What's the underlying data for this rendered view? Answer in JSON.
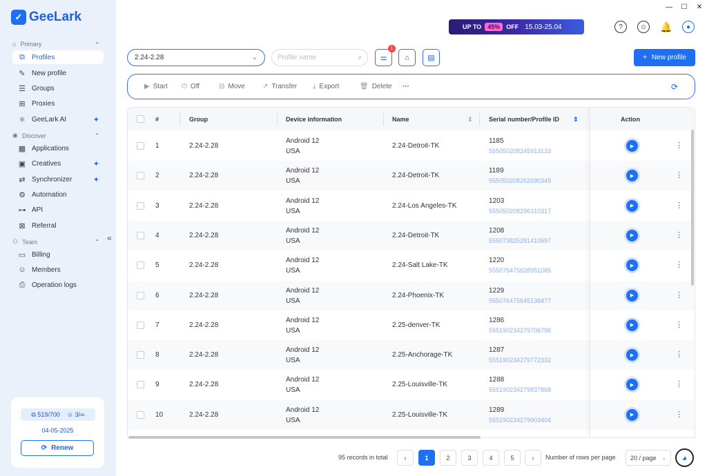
{
  "app": {
    "logo_text": "GeeLark",
    "logo_icon": "geelark-logo-icon"
  },
  "sidebar": {
    "sections": [
      {
        "label": "Primary",
        "icon": "home-icon"
      },
      {
        "label": "Discover",
        "icon": "eye-icon"
      },
      {
        "label": "Team",
        "icon": "team-icon"
      }
    ],
    "items": [
      {
        "label": "Profiles",
        "icon": "profiles-icon",
        "active": true
      },
      {
        "label": "New profile",
        "icon": "edit-icon"
      },
      {
        "label": "Groups",
        "icon": "list-icon"
      },
      {
        "label": "Proxies",
        "icon": "proxy-icon"
      },
      {
        "label": "GeeLark AI",
        "icon": "ai-icon",
        "badge": true
      },
      {
        "label": "Applications",
        "icon": "apps-icon"
      },
      {
        "label": "Creatives",
        "icon": "creatives-icon",
        "badge": true
      },
      {
        "label": "Synchronizer",
        "icon": "sync-icon",
        "badge": true
      },
      {
        "label": "Automation",
        "icon": "automation-icon"
      },
      {
        "label": "API",
        "icon": "api-icon"
      },
      {
        "label": "Referral",
        "icon": "referral-icon"
      },
      {
        "label": "Billing",
        "icon": "billing-icon"
      },
      {
        "label": "Members",
        "icon": "members-icon"
      },
      {
        "label": "Operation logs",
        "icon": "logs-icon"
      }
    ],
    "quota": {
      "profiles": "519/700",
      "members": "3/∞",
      "date": "04-05-2025",
      "renew_label": "Renew"
    }
  },
  "promo": {
    "prefix": "UP TO",
    "percent": "45%",
    "suffix": "OFF",
    "dates": "15.03-25.04"
  },
  "filters": {
    "group_value": "2.24-2.28",
    "search_placeholder": "Profile name",
    "notification_count": "1",
    "new_profile_label": "New profile"
  },
  "toolbar": {
    "start": "Start",
    "off": "Off",
    "move": "Move",
    "transfer": "Transfer",
    "export": "Export",
    "delete": "Delete",
    "more": "···"
  },
  "table": {
    "headers": {
      "num": "#",
      "group": "Group",
      "device": "Device information",
      "name": "Name",
      "serial": "Serial number/Profile ID",
      "action": "Action"
    },
    "rows": [
      {
        "num": "1",
        "group": "2.24-2.28",
        "os": "Android 12",
        "region": "USA",
        "name": "2.24-Detroit-TK",
        "serial": "1185",
        "pid": "555050208245913133"
      },
      {
        "num": "2",
        "group": "2.24-2.28",
        "os": "Android 12",
        "region": "USA",
        "name": "2.24-Detroit-TK",
        "serial": "1189",
        "pid": "555050208262690349"
      },
      {
        "num": "3",
        "group": "2.24-2.28",
        "os": "Android 12",
        "region": "USA",
        "name": "2.24-Los Angeles-TK",
        "serial": "1203",
        "pid": "555050208296310317"
      },
      {
        "num": "4",
        "group": "2.24-2.28",
        "os": "Android 12",
        "region": "USA",
        "name": "2.24-Detroit-TK",
        "serial": "1208",
        "pid": "555073825281410697"
      },
      {
        "num": "5",
        "group": "2.24-2.28",
        "os": "Android 12",
        "region": "USA",
        "name": "2.24-Salt Lake-TK",
        "serial": "1220",
        "pid": "555076475628951085"
      },
      {
        "num": "6",
        "group": "2.24-2.28",
        "os": "Android 12",
        "region": "USA",
        "name": "2.24-Phoenix-TK",
        "serial": "1229",
        "pid": "555076475645138477"
      },
      {
        "num": "7",
        "group": "2.24-2.28",
        "os": "Android 12",
        "region": "USA",
        "name": "2.25-denver-TK",
        "serial": "1286",
        "pid": "555190234279706796"
      },
      {
        "num": "8",
        "group": "2.24-2.28",
        "os": "Android 12",
        "region": "USA",
        "name": "2.25-Anchorage-TK",
        "serial": "1287",
        "pid": "555190234279772332"
      },
      {
        "num": "9",
        "group": "2.24-2.28",
        "os": "Android 12",
        "region": "USA",
        "name": "2.25-Louisville-TK",
        "serial": "1288",
        "pid": "555190234279837868"
      },
      {
        "num": "10",
        "group": "2.24-2.28",
        "os": "Android 12",
        "region": "USA",
        "name": "2.25-Louisville-TK",
        "serial": "1289",
        "pid": "555190234279903404"
      }
    ]
  },
  "pagination": {
    "total": "95 records in total",
    "pages": [
      "1",
      "2",
      "3",
      "4",
      "5"
    ],
    "current": "1",
    "rows_label": "Number of rows per page",
    "rows_value": "20 / page"
  },
  "colors": {
    "accent": "#1e6ff1",
    "sidebar_bg": "#eaf1fb",
    "id_text": "#8ab0ee"
  }
}
